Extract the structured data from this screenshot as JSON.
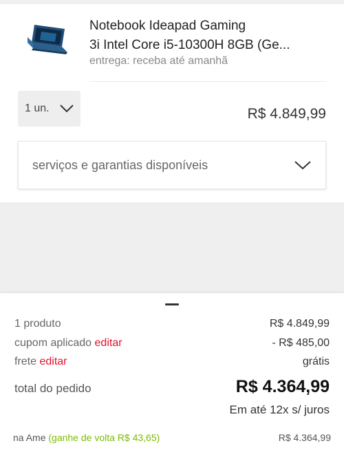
{
  "product": {
    "image_icon": "laptop-icon",
    "title_line1": "Notebook Ideapad Gaming",
    "title_line2": "3i Intel Core i5-10300H 8GB (Ge...",
    "delivery": "entrega: receba até amanhã"
  },
  "quantity": {
    "selected": "1 un."
  },
  "item_price": "R$ 4.849,99",
  "services": {
    "label": "serviços e garantias disponíveis"
  },
  "summary": {
    "products_label": "1 produto",
    "products_value": "R$ 4.849,99",
    "coupon_label": "cupom aplicado",
    "coupon_edit": "editar",
    "coupon_value": "- R$ 485,00",
    "shipping_label": "frete",
    "shipping_edit": "editar",
    "shipping_value": "grátis",
    "total_label": "total do pedido",
    "total_value": "R$ 4.364,99",
    "installments": "Em até 12x s/ juros",
    "ame_prefix": "na Ame",
    "ame_cashback": "(ganhe de volta R$ 43,65)",
    "ame_value": "R$ 4.364,99"
  },
  "colors": {
    "edit_red": "#e0102b",
    "discount_green": "#7cbb00"
  }
}
